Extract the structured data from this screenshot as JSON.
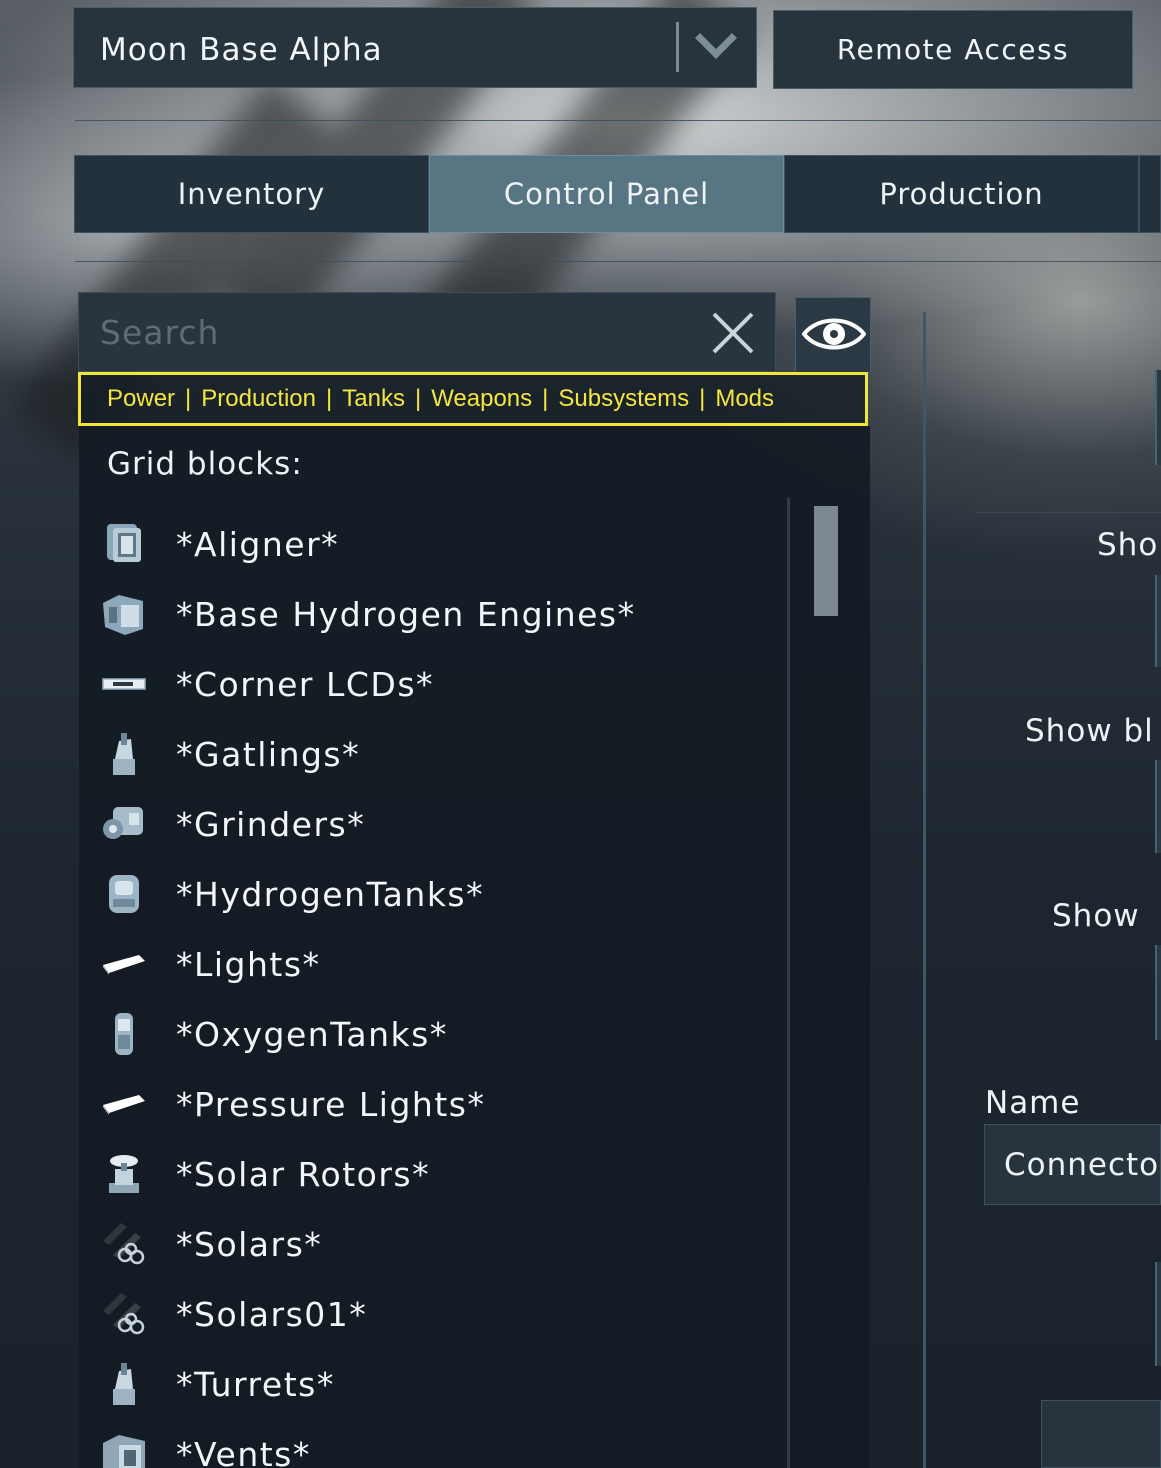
{
  "header": {
    "grid_name": "Moon Base Alpha",
    "remote_access_label": "Remote Access"
  },
  "tabs": [
    {
      "label": "Inventory",
      "active": false
    },
    {
      "label": "Control Panel",
      "active": true
    },
    {
      "label": "Production",
      "active": false
    }
  ],
  "search": {
    "placeholder": "Search",
    "value": ""
  },
  "filters": [
    "Power",
    "Production",
    "Tanks",
    "Weapons",
    "Subsystems",
    "Mods"
  ],
  "block_list": {
    "header": "Grid blocks:",
    "items": [
      {
        "label": "*Aligner*",
        "icon": "cube-block-icon"
      },
      {
        "label": "*Base Hydrogen Engines*",
        "icon": "hydrogen-engine-icon"
      },
      {
        "label": "*Corner LCDs*",
        "icon": "corner-lcd-icon"
      },
      {
        "label": "*Gatlings*",
        "icon": "gatling-turret-icon"
      },
      {
        "label": "*Grinders*",
        "icon": "grinder-icon"
      },
      {
        "label": "*HydrogenTanks*",
        "icon": "hydrogen-tank-icon"
      },
      {
        "label": "*Lights*",
        "icon": "light-panel-icon"
      },
      {
        "label": "*OxygenTanks*",
        "icon": "oxygen-tank-icon"
      },
      {
        "label": "*Pressure Lights*",
        "icon": "light-panel-icon"
      },
      {
        "label": "*Solar Rotors*",
        "icon": "rotor-icon"
      },
      {
        "label": "*Solars*",
        "icon": "solar-panel-icon"
      },
      {
        "label": "*Solars01*",
        "icon": "solar-panel-icon"
      },
      {
        "label": "*Turrets*",
        "icon": "turret-icon"
      },
      {
        "label": "*Vents*",
        "icon": "vent-icon"
      }
    ]
  },
  "right_panel": {
    "label_1": "Sho",
    "label_2": "Show bl",
    "label_3": "Show",
    "name_label": "Name",
    "name_value": "Connecto"
  },
  "colors": {
    "filter_highlight": "#f1e63a",
    "active_tab": "#587584",
    "panel_bg": "#131b23"
  }
}
